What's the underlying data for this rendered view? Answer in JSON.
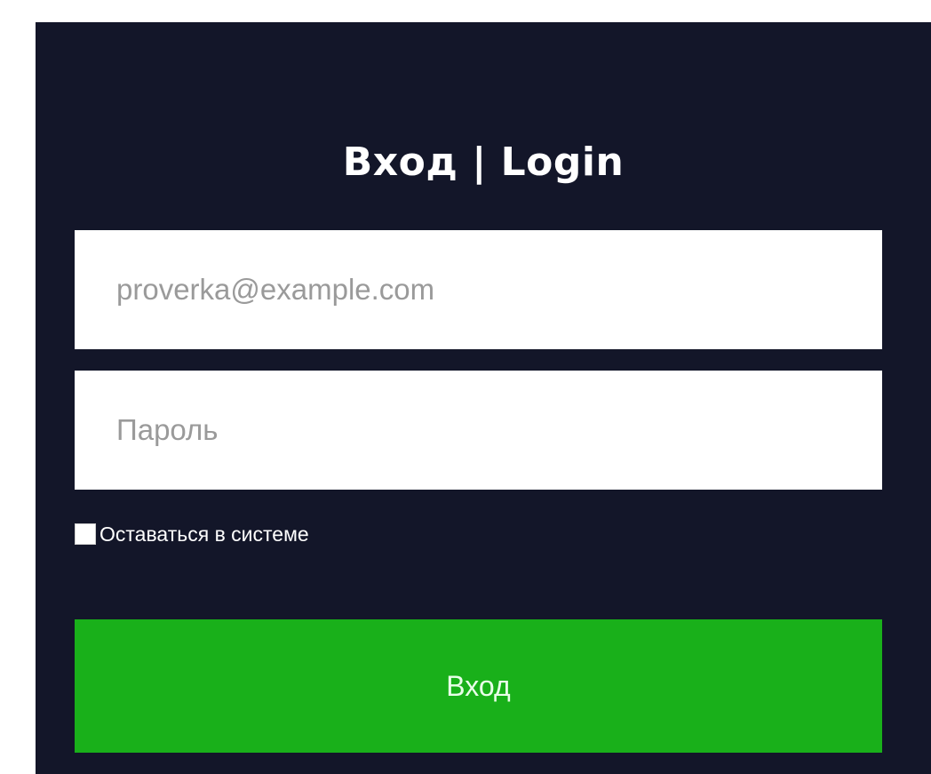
{
  "login": {
    "title": "Вход | Login",
    "email_placeholder": "proverka@example.com",
    "email_value": "",
    "password_placeholder": "Пароль",
    "password_value": "",
    "remember_label": "Оставаться в системе",
    "remember_checked": false,
    "submit_label": "Вход"
  },
  "colors": {
    "panel_background": "#131629",
    "submit_button": "#19b01a",
    "title_text": "#ffffff"
  }
}
